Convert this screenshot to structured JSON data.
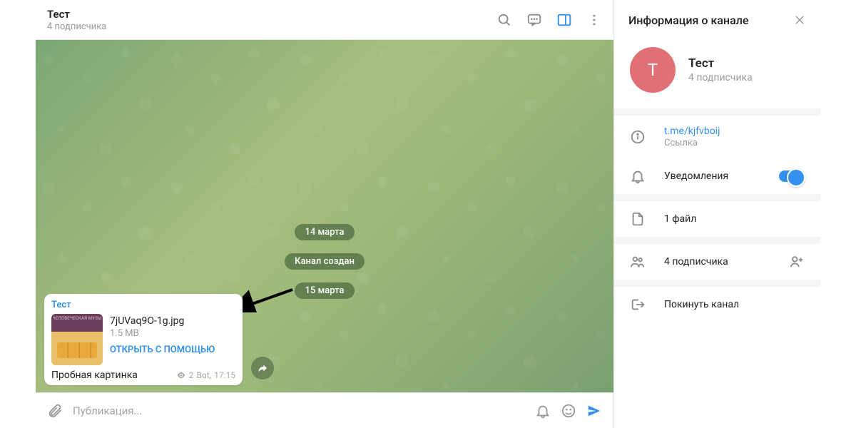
{
  "header": {
    "title": "Тест",
    "subtitle": "4 подписчика"
  },
  "chat": {
    "date1": "14 марта",
    "service": "Канал создан",
    "date2": "15 марта",
    "message": {
      "sender": "Тест",
      "filename": "7jUVaq9O-1g.jpg",
      "filesize": "1.5 MB",
      "open_label": "ОТКРЫТЬ С ПОМОЩЬЮ",
      "caption": "Пробная картинка",
      "views": "2",
      "author": "Bot,",
      "time": "17:15"
    }
  },
  "composer": {
    "placeholder": "Публикация..."
  },
  "sidebar": {
    "header": "Информация о канале",
    "avatar_letter": "Т",
    "name": "Тест",
    "subtitle": "4 подписчика",
    "link": {
      "url": "t.me/kjfvboij",
      "label": "Ссылка"
    },
    "notifications": "Уведомления",
    "files": "1 файл",
    "subscribers": "4 подписчика",
    "leave": "Покинуть канал"
  }
}
